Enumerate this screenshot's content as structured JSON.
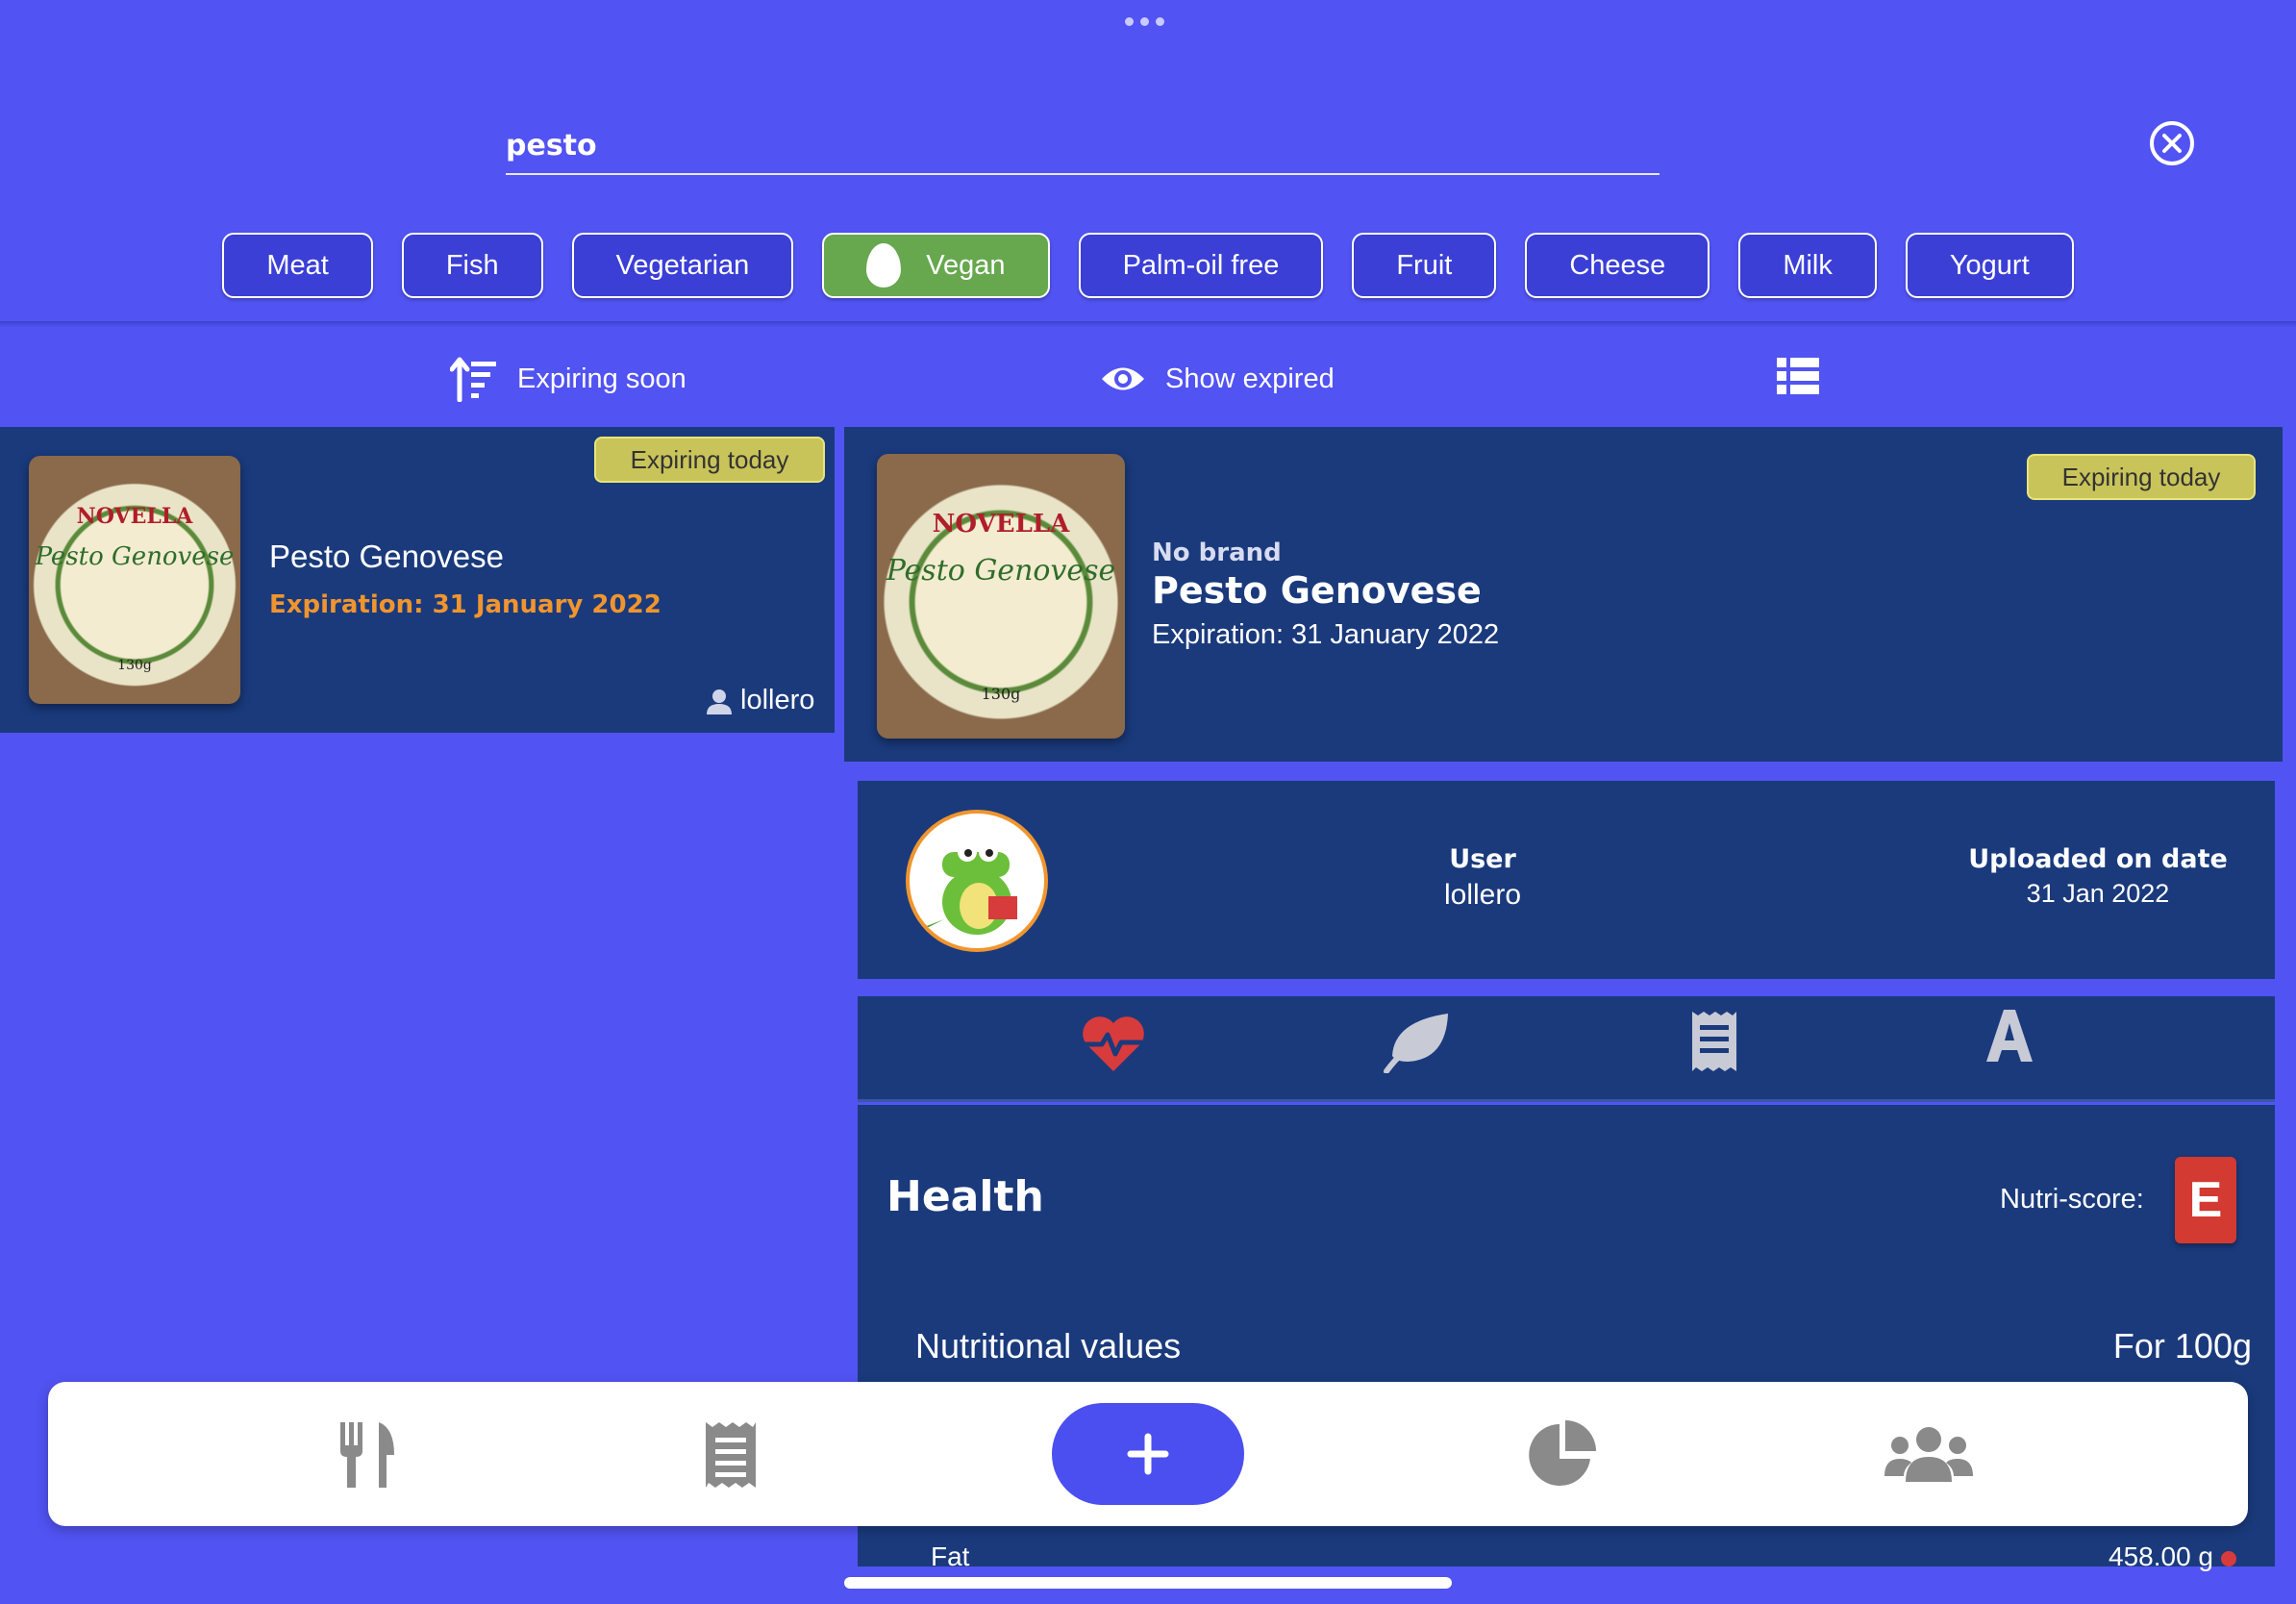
{
  "search": {
    "value": "pesto"
  },
  "filters": [
    {
      "label": "Meat",
      "active": false
    },
    {
      "label": "Fish",
      "active": false
    },
    {
      "label": "Vegetarian",
      "active": false
    },
    {
      "label": "Vegan",
      "active": true,
      "icon": "egg-icon"
    },
    {
      "label": "Palm-oil free",
      "active": false
    },
    {
      "label": "Fruit",
      "active": false
    },
    {
      "label": "Cheese",
      "active": false
    },
    {
      "label": "Milk",
      "active": false
    },
    {
      "label": "Yogurt",
      "active": false
    }
  ],
  "toolbar": {
    "sort_label": "Expiring soon",
    "show_expired_label": "Show expired"
  },
  "list": {
    "items": [
      {
        "badge": "Expiring today",
        "name": "Pesto Genovese",
        "expiration": "Expiration: 31 January 2022",
        "user": "lollero"
      }
    ]
  },
  "detail": {
    "badge": "Expiring today",
    "brand": "No brand",
    "name": "Pesto Genovese",
    "expiration": "Expiration: 31 January 2022",
    "user_label": "User",
    "user_value": "lollero",
    "uploaded_label": "Uploaded on date",
    "uploaded_value": "31 Jan 2022",
    "section_title": "Health",
    "nutriscore_label": "Nutri-score:",
    "nutriscore_value": "E",
    "nutritional_label": "Nutritional values",
    "per_label": "For 100g",
    "fat_label": "Fat",
    "fat_value": "458.00 g"
  },
  "product_image": {
    "brand_text": "NOVELLA",
    "product_text": "Pesto Genovese",
    "weight": "130g"
  },
  "colors": {
    "background": "#5153f2",
    "card": "#1a3a7c",
    "active_chip": "#67a84f",
    "badge": "#c9c45a",
    "expiration_orange": "#f0952e",
    "nutriscore_e": "#d23a32",
    "heart_red": "#d83b3b"
  }
}
